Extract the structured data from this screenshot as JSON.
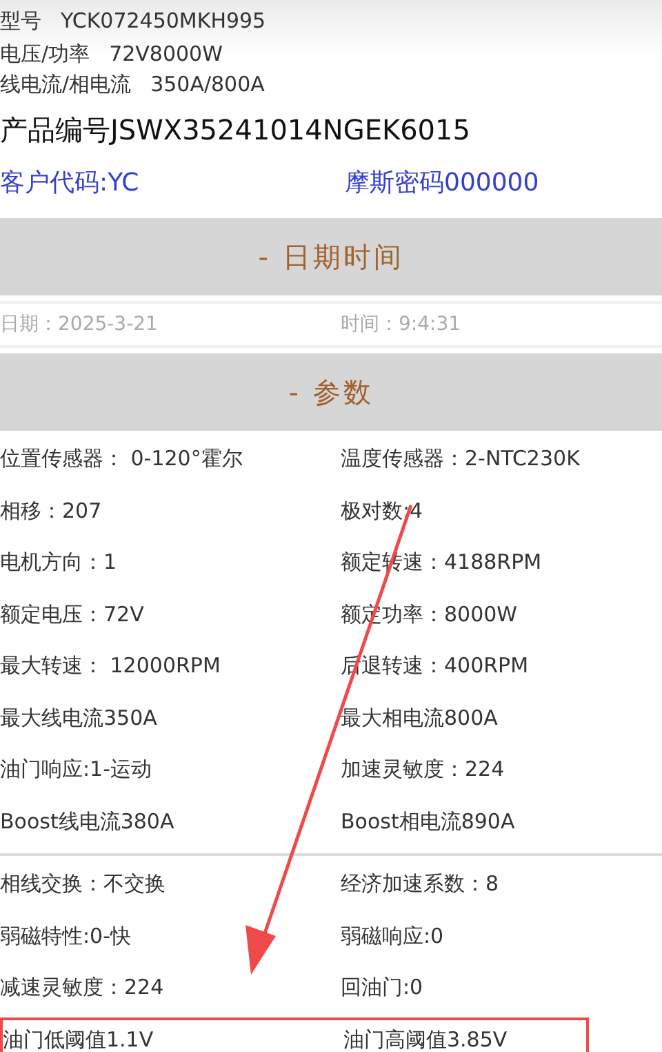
{
  "info_lines": [
    {
      "label": "型号",
      "value": "YCK072450MKH995"
    },
    {
      "label": "电压/功率",
      "value": "72V8000W"
    },
    {
      "label": "线电流/相电流",
      "value": "350A/800A"
    }
  ],
  "product_no": "产品编号JSWX35241014NGEK6015",
  "customer": {
    "code": "客户代码:YC",
    "morse": "摩斯密码000000"
  },
  "datetime_section": {
    "header": "- 日期时间",
    "date": "日期：2025-3-21",
    "time": "时间：9:4:31"
  },
  "params_section": {
    "header": "- 参数",
    "groups": [
      [
        {
          "left": "位置传感器：  0-120°霍尔",
          "right": "温度传感器：2-NTC230K",
          "highlighted": false
        },
        {
          "left": "相移：207",
          "right": "极对数:4",
          "highlighted": false
        },
        {
          "left": "电机方向：1",
          "right": "额定转速：4188RPM",
          "highlighted": false
        },
        {
          "left": "额定电压：72V",
          "right": "额定功率：8000W",
          "highlighted": false
        },
        {
          "left": "最大转速：  12000RPM",
          "right": "后退转速：400RPM",
          "highlighted": false
        },
        {
          "left": "最大线电流350A",
          "right": "最大相电流800A",
          "highlighted": false
        },
        {
          "left": "油门响应:1-运动",
          "right": "加速灵敏度：224",
          "highlighted": false
        },
        {
          "left": "Boost线电流380A",
          "right": "Boost相电流890A",
          "highlighted": false
        }
      ],
      [
        {
          "left": "相线交换：不交换",
          "right": "经济加速系数：8",
          "highlighted": false
        },
        {
          "left": "弱磁特性:0-快",
          "right": "弱磁响应:0",
          "highlighted": false
        },
        {
          "left": "减速灵敏度：224",
          "right": "回油门:0",
          "highlighted": false
        },
        {
          "left": "油门低阈值1.1V",
          "right": "油门高阈值3.85V",
          "highlighted": true
        }
      ]
    ]
  },
  "annotation_arrow": true
}
